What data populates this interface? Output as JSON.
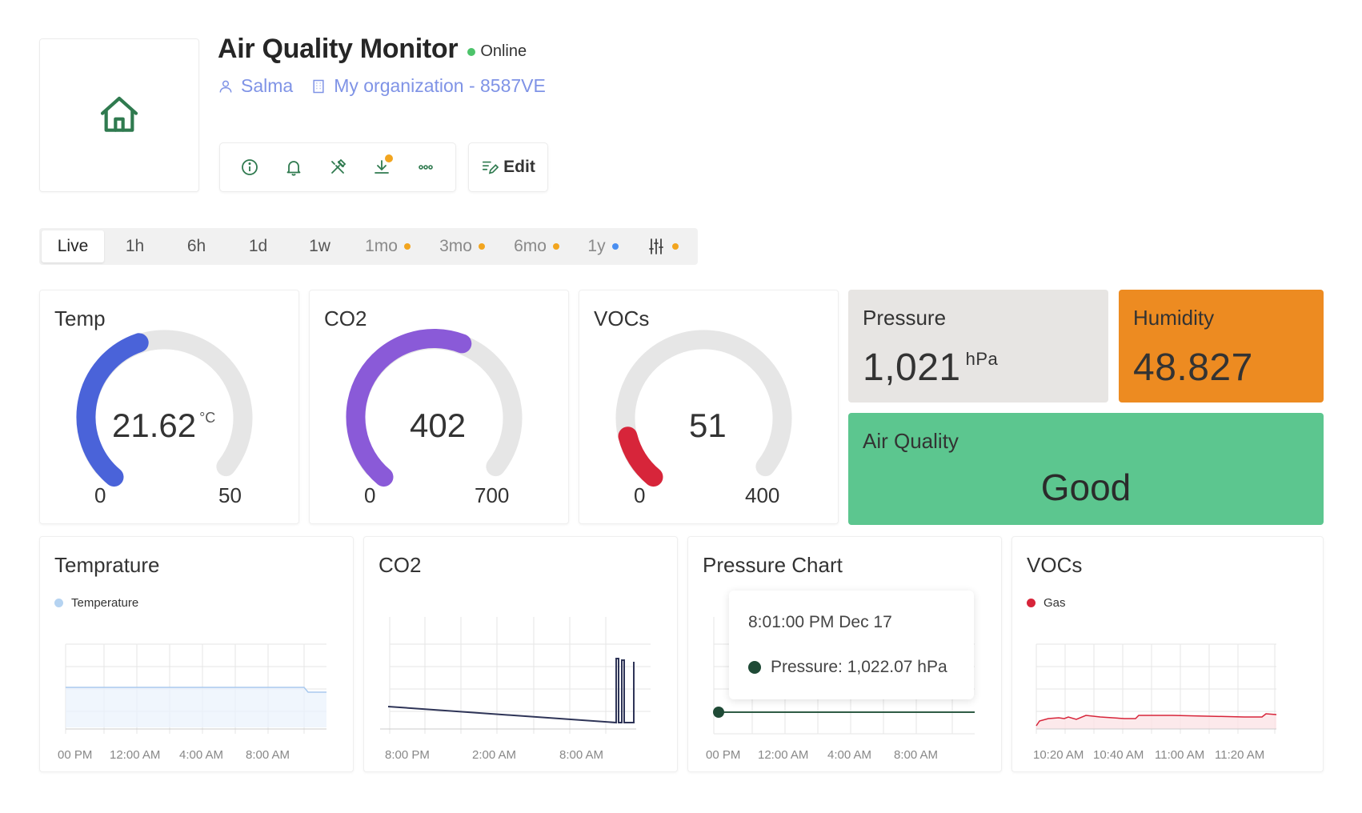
{
  "header": {
    "title": "Air Quality Monitor",
    "status": "Online",
    "user": "Salma",
    "organization": "My organization - 8587VE",
    "edit_label": "Edit"
  },
  "toolbar": {
    "icons": [
      "info-icon",
      "bell-icon",
      "tools-icon",
      "download-icon",
      "more-icon"
    ]
  },
  "range_tabs": {
    "live": "Live",
    "h1": "1h",
    "h6": "6h",
    "d1": "1d",
    "w1": "1w",
    "mo1": "1mo",
    "mo3": "3mo",
    "mo6": "6mo",
    "y1": "1y"
  },
  "gauges": {
    "temp": {
      "title": "Temp",
      "value": "21.62",
      "unit": "°C",
      "min": "0",
      "max": "50",
      "level": 0.4324,
      "color": "#4a63d9"
    },
    "co2": {
      "title": "CO2",
      "value": "402",
      "min": "0",
      "max": "700",
      "level": 0.5743,
      "color": "#8a5ad8"
    },
    "vocs": {
      "title": "VOCs",
      "value": "51",
      "min": "0",
      "max": "400",
      "level": 0.1275,
      "color": "#d7253a"
    }
  },
  "stats": {
    "pressure": {
      "title": "Pressure",
      "value": "1,021",
      "unit": "hPa",
      "color": "#e7e5e3"
    },
    "humidity": {
      "title": "Humidity",
      "value": "48.827",
      "color": "#ed8b21"
    },
    "air_quality": {
      "title": "Air Quality",
      "value": "Good",
      "color": "#5cc68f"
    }
  },
  "charts": {
    "temperature": {
      "title": "Temprature",
      "legend": "Temperature",
      "legend_color": "#b5d3f1",
      "ticks": [
        "00 PM",
        "12:00 AM",
        "4:00 AM",
        "8:00 AM"
      ]
    },
    "co2": {
      "title": "CO2",
      "ticks": [
        "8:00 PM",
        "2:00 AM",
        "8:00 AM"
      ]
    },
    "pressure": {
      "title": "Pressure Chart",
      "ticks": [
        "00 PM",
        "12:00 AM",
        "4:00 AM",
        "8:00 AM"
      ],
      "tooltip_time": "8:01:00 PM Dec 17",
      "tooltip_value": "Pressure: 1,022.07 hPa"
    },
    "vocs": {
      "title": "VOCs",
      "legend": "Gas",
      "legend_color": "#d7253a",
      "ticks": [
        "10:20 AM",
        "10:40 AM",
        "11:00 AM",
        "11:20 AM"
      ]
    }
  }
}
